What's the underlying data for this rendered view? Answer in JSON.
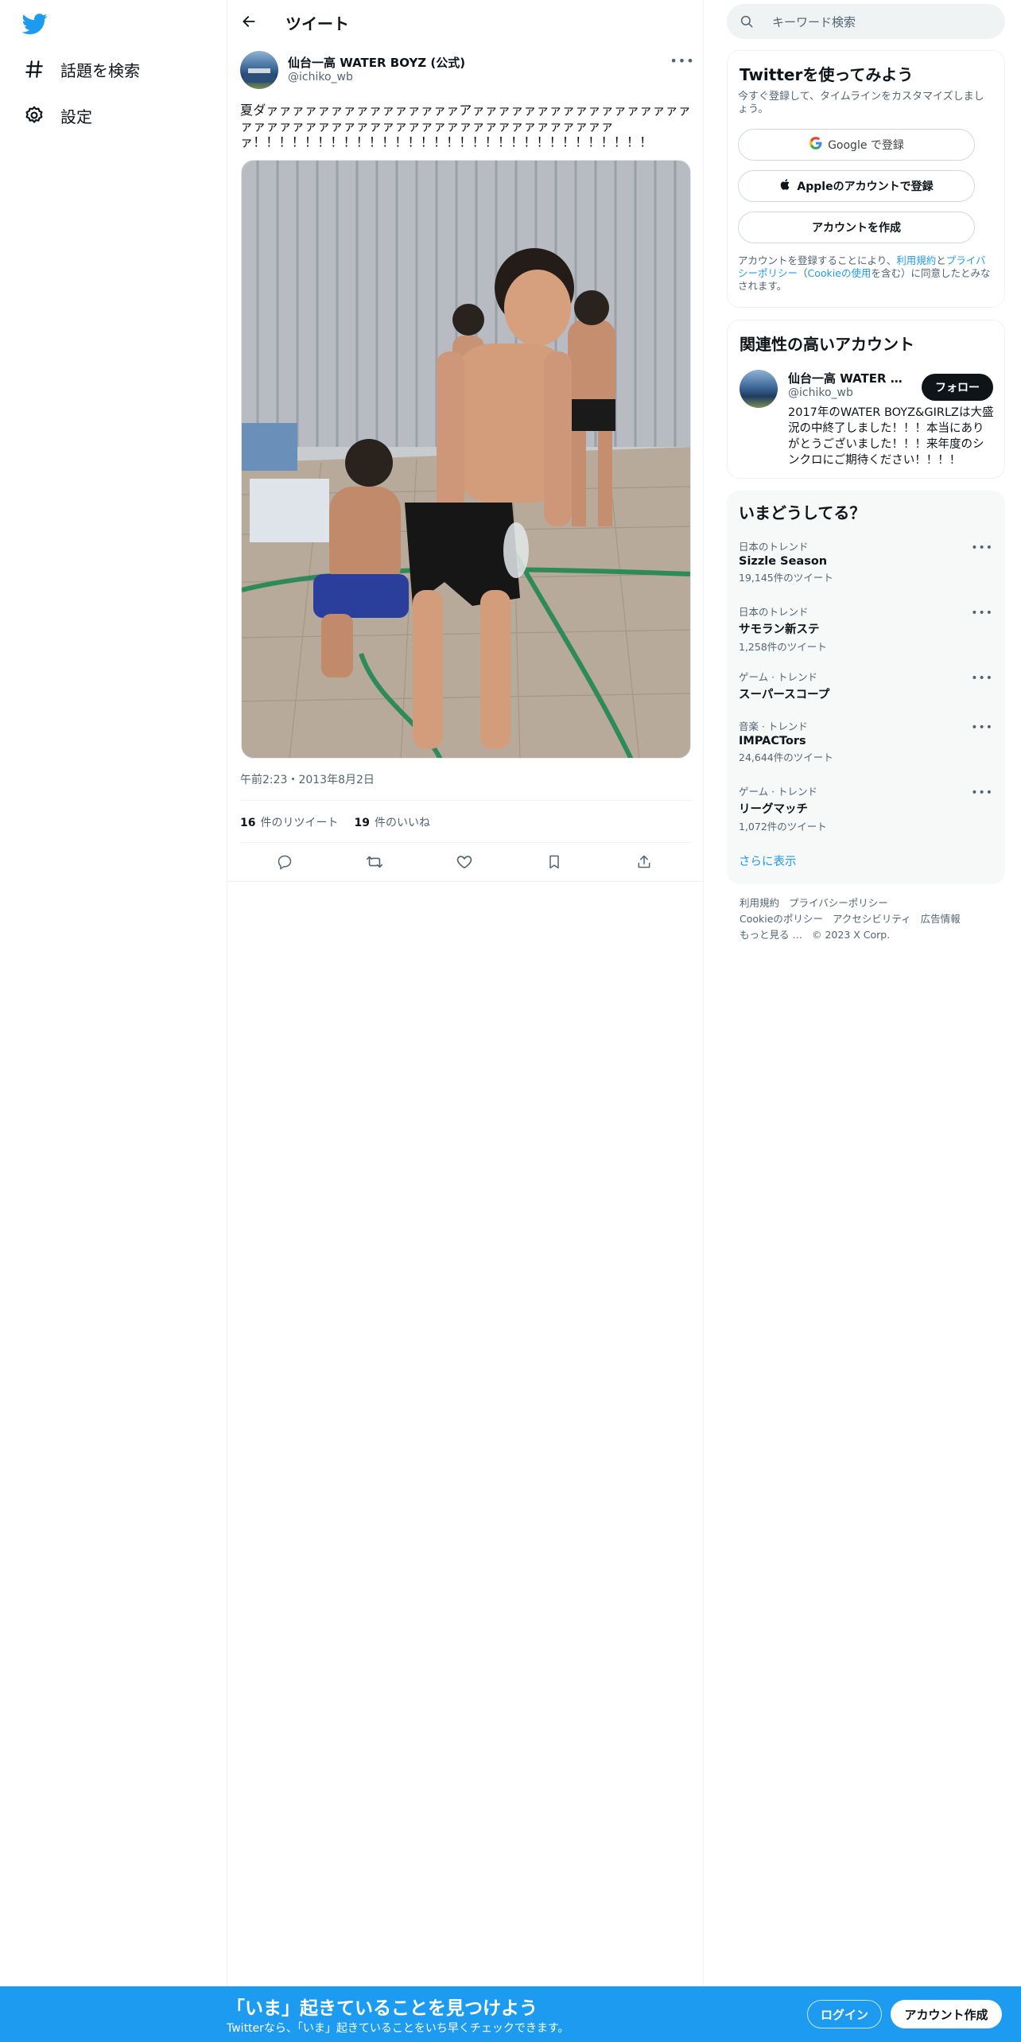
{
  "nav": {
    "logo_icon": "twitter-bird-icon",
    "items": [
      {
        "label": "話題を検索",
        "icon": "hashtag-icon"
      },
      {
        "label": "設定",
        "icon": "gear-icon"
      }
    ]
  },
  "header": {
    "title": "ツイート"
  },
  "tweet": {
    "author_name": "仙台一高 WATER BOYZ (公式)",
    "author_handle": "@ichiko_wb",
    "text": "夏ダァァァァァァァァァァァァァァァアァァァァァァァァァァァァァァァァァァァァァァァァァァァァァァァァァァァァァァァァァァァァァァァ！！！！！！！！！！！！！！！！！！！！！！！！！！！！！！！",
    "timestamp": "午前2:23・2013年8月2日",
    "retweets_count": "16",
    "retweets_label": "件のリツイート",
    "likes_count": "19",
    "likes_label": "件のいいね"
  },
  "search": {
    "placeholder": "キーワード検索"
  },
  "signup": {
    "title": "Twitterを使ってみよう",
    "subtitle": "今すぐ登録して、タイムラインをカスタマイズしましょう。",
    "google_label": "Google で登録",
    "apple_label": "Appleのアカウントで登録",
    "create_label": "アカウントを作成",
    "terms_prefix": "アカウントを登録することにより、",
    "terms_link1": "利用規約",
    "terms_and": "と",
    "terms_link2": "プライバシーポリシー",
    "terms_paren_open": "（",
    "terms_link3": "Cookieの使用",
    "terms_suffix": "を含む）に同意したとみなされます。"
  },
  "related": {
    "title": "関連性の高いアカウント",
    "name": "仙台一高 WATER BOYZ (公式)",
    "handle": "@ichiko_wb",
    "follow_label": "フォロー",
    "bio": "2017年のWATER BOYZ&GIRLZは大盛況の中終了しました！！！本当にありがとうございました！！！来年度のシンクロにご期待ください！！！！"
  },
  "trends": {
    "title": "いまどうしてる？",
    "items": [
      {
        "context": "日本のトレンド",
        "name": "Sizzle Season",
        "count": "19,145件のツイート"
      },
      {
        "context": "日本のトレンド",
        "name": "サモラン新ステ",
        "count": "1,258件のツイート"
      },
      {
        "context": "ゲーム · トレンド",
        "name": "スーパースコープ",
        "count": ""
      },
      {
        "context": "音楽 · トレンド",
        "name": "IMPACTors",
        "count": "24,644件のツイート"
      },
      {
        "context": "ゲーム · トレンド",
        "name": "リーグマッチ",
        "count": "1,072件のツイート"
      }
    ],
    "show_more": "さらに表示"
  },
  "footer": {
    "links": [
      "利用規約",
      "プライバシーポリシー",
      "Cookieのポリシー",
      "アクセシビリティ",
      "広告情報",
      "もっと見る …",
      "© 2023 X Corp."
    ]
  },
  "bottom_bar": {
    "title": "「いま」起きていることを見つけよう",
    "subtitle": "Twitterなら、「いま」起きていることをいち早くチェックできます。",
    "login_label": "ログイン",
    "signup_label": "アカウント作成"
  },
  "colors": {
    "accent": "#1d9bf0",
    "text": "#0f1419",
    "muted": "#536471"
  }
}
